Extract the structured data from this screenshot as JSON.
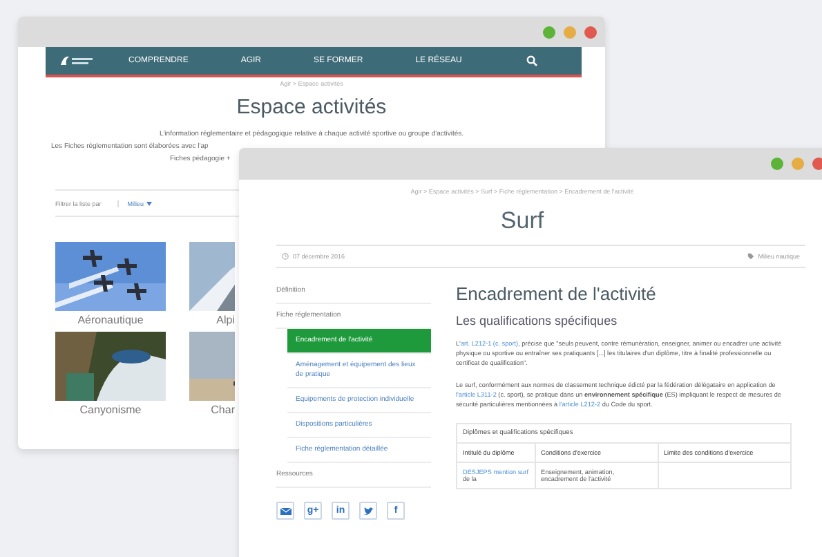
{
  "back_window": {
    "nav": {
      "items": [
        {
          "label": "COMPRENDRE"
        },
        {
          "label": "AGIR"
        },
        {
          "label": "SE FORMER"
        },
        {
          "label": "LE RÉSEAU"
        }
      ]
    },
    "breadcrumb": "Agir > Espace activités",
    "title": "Espace activités",
    "intro": [
      "L'information réglementaire et pédagogique relative à chaque activité sportive ou groupe d'activités.",
      "Les Fiches réglementation sont élaborées avec l'ap",
      "Fiches pédagogie +"
    ],
    "filter": {
      "label": "Filtrer la liste par",
      "value": "Milieu"
    },
    "tiles": [
      {
        "label": "Aéronautique"
      },
      {
        "label": "Alpi"
      },
      {
        "label": "Canyonisme"
      },
      {
        "label": "Char"
      }
    ]
  },
  "front_window": {
    "breadcrumb": "Agir > Espace activités > Surf > Fiche réglementation > Encadrement de l'activité",
    "title": "Surf",
    "date": "07 décembre 2016",
    "tag": "Milieu nautique",
    "sidebar": [
      {
        "label": "Définition",
        "selected": false
      },
      {
        "label": "Fiche réglementation",
        "selected": false,
        "children": [
          {
            "label": "Encadrement de l'activité",
            "selected": true
          },
          {
            "label": "Aménagement et équipement des lieux de pratique",
            "selected": false
          },
          {
            "label": "Equipements de protection individuelle",
            "selected": false
          },
          {
            "label": "Dispositions particulières",
            "selected": false
          },
          {
            "label": "Fiche réglementation détaillée",
            "selected": false
          }
        ]
      },
      {
        "label": "Ressources",
        "selected": false
      }
    ],
    "share": [
      {
        "kind": "email"
      },
      {
        "kind": "gplus",
        "label": "g+"
      },
      {
        "kind": "linkedin",
        "label": "in"
      },
      {
        "kind": "twitter"
      },
      {
        "kind": "facebook",
        "label": "f"
      }
    ],
    "heading": "Encadrement de l'activité",
    "subheading": "Les qualifications spécifiques",
    "paragraphs": [
      [
        {
          "kind": "plain",
          "text": "L'"
        },
        {
          "kind": "link",
          "text": "art. L212-1 (c. sport)"
        },
        {
          "kind": "plain",
          "text": ", précise que \"seuls peuvent, contre rémunération, enseigner, animer ou encadrer une activité physique ou sportive ou entraîner ses pratiquants [...] les titulaires d'un diplôme, titre à finalité professionnelle ou certificat de qualification\"."
        }
      ],
      [
        {
          "kind": "plain",
          "text": "Le surf, conformément aux normes de classement technique édicté par la fédération délégataire en application de "
        },
        {
          "kind": "link",
          "text": "l'article L311-2"
        },
        {
          "kind": "plain",
          "text": " (c. sport), se pratique dans un "
        },
        {
          "kind": "bold",
          "text": "environnement spécifique"
        },
        {
          "kind": "plain",
          "text": " (ES) impliquant le respect de mesures de sécurité particulières mentionnées à "
        },
        {
          "kind": "link",
          "text": "l'article L212-2"
        },
        {
          "kind": "plain",
          "text": " du Code du sport."
        }
      ]
    ],
    "table": {
      "caption": "Diplômes et qualifications spécifiques",
      "columns": [
        "Intitulé du diplôme",
        "Conditions d'exercice",
        "Limite des conditions d'exercice"
      ],
      "rows": [
        [
          {
            "link": "DESJEPS mention surf",
            "text": " de la"
          },
          {
            "text": "Enseignement, animation, encadrement de l'activité"
          }
        ]
      ]
    }
  }
}
